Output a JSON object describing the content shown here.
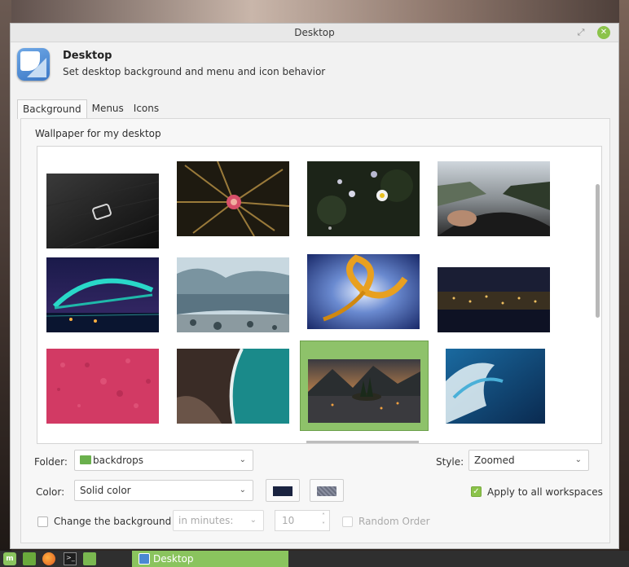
{
  "window": {
    "title": "Desktop"
  },
  "app": {
    "name": "Desktop",
    "description": "Set desktop background and menu and icon behavior"
  },
  "tabs": [
    {
      "label": "Background",
      "active": true
    },
    {
      "label": "Menus",
      "active": false
    },
    {
      "label": "Icons",
      "active": false
    }
  ],
  "background": {
    "section_label": "Wallpaper for my desktop",
    "wallpapers": [
      {
        "name": "mint-logo-dark",
        "selected": false
      },
      {
        "name": "dried-flower",
        "selected": false
      },
      {
        "name": "daisies-dark",
        "selected": false
      },
      {
        "name": "steering-wheel-road",
        "selected": false
      },
      {
        "name": "bridge-night",
        "selected": false
      },
      {
        "name": "icy-lake-reflection",
        "selected": false
      },
      {
        "name": "abstract-swirl",
        "selected": false
      },
      {
        "name": "city-lights-night",
        "selected": false
      },
      {
        "name": "pink-texture",
        "selected": false
      },
      {
        "name": "aerial-beach",
        "selected": false
      },
      {
        "name": "lake-island-mountains",
        "selected": true
      },
      {
        "name": "ocean-wave",
        "selected": false
      }
    ],
    "folder": {
      "label": "Folder:",
      "value": "backdrops"
    },
    "style": {
      "label": "Style:",
      "value": "Zoomed"
    },
    "color": {
      "label": "Color:",
      "value": "Solid color",
      "primary": "#1a2340",
      "secondary": "#8a8fa0"
    },
    "apply_all": {
      "label": "Apply to all workspaces",
      "checked": true
    },
    "change_bg": {
      "label": "Change the background",
      "checked": false
    },
    "interval": {
      "value": "in minutes:"
    },
    "minutes": {
      "value": "10"
    },
    "random": {
      "label": "Random Order",
      "checked": false
    }
  },
  "taskbar": {
    "active_window": "Desktop",
    "launchers": [
      "mint-menu-icon",
      "show-desktop-icon",
      "firefox-icon",
      "terminal-icon",
      "files-icon"
    ]
  },
  "colors": {
    "accent": "#8bc34a",
    "selection": "#8ec26a"
  }
}
